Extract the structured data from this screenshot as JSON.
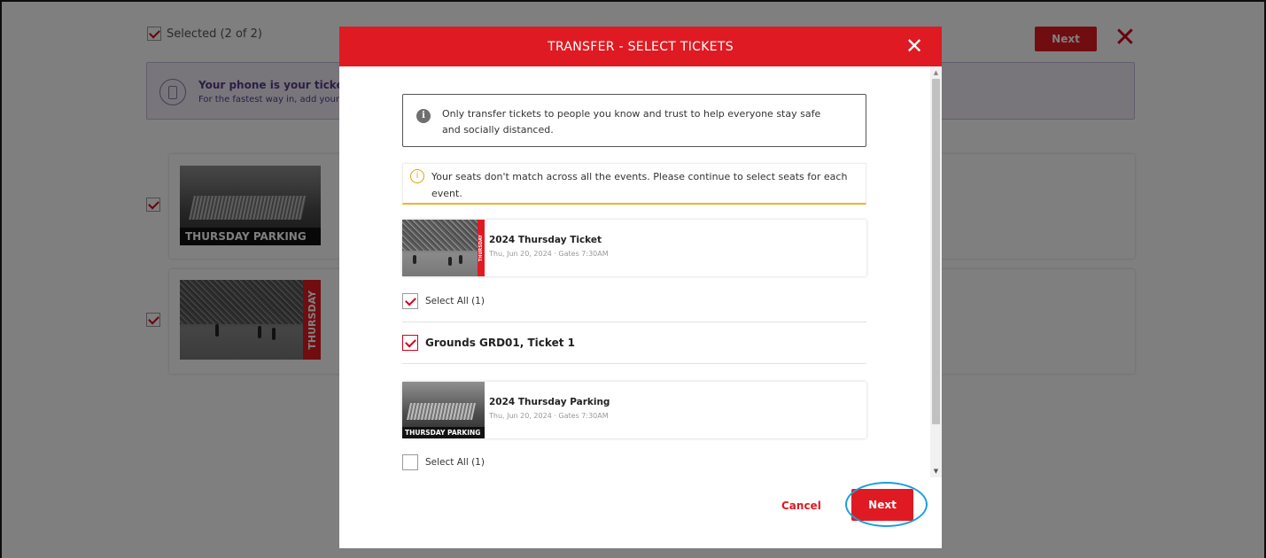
{
  "background": {
    "selected_label": "Selected (2 of 2)",
    "next_label": "Next",
    "close_glyph": "✕",
    "banner": {
      "title": "Your phone is your ticket.",
      "subtitle": "For the fastest way in, add your"
    },
    "cards": [
      {
        "thumb_label": "THURSDAY PARKING",
        "checked": true
      },
      {
        "thumb_label": "THURSDAY",
        "checked": true
      }
    ]
  },
  "modal": {
    "title": "TRANSFER - SELECT TICKETS",
    "close_glyph": "✕",
    "info_text": "Only transfer tickets to people you know and trust to help everyone stay safe and socially distanced.",
    "warning_text": "Your seats don't match across all the events. Please continue to select seats for each event.",
    "events": [
      {
        "name": "2024 Thursday Ticket",
        "date": "Thu, Jun 20, 2024 · Gates 7:30AM",
        "thumb_label": "THURSDAY",
        "select_all_label": "Select All (1)",
        "select_all_checked": true,
        "tickets": [
          {
            "label": "Grounds GRD01, Ticket 1",
            "checked": true
          }
        ]
      },
      {
        "name": "2024 Thursday Parking",
        "date": "Thu, Jun 20, 2024 · Gates 7:30AM",
        "thumb_label": "THURSDAY PARKING",
        "select_all_label": "Select All (1)",
        "select_all_checked": false
      }
    ],
    "cancel_label": "Cancel",
    "next_label": "Next"
  },
  "colors": {
    "brand_red": "#e01a22",
    "warning": "#f0b429",
    "highlight": "#1d9fd8",
    "banner_bg": "#f1ecf7"
  }
}
